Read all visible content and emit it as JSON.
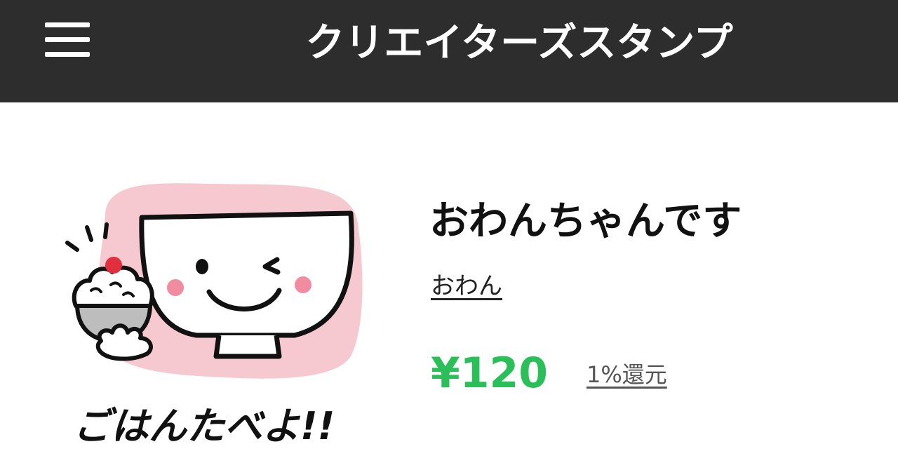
{
  "header": {
    "title": "クリエイターズスタンプ",
    "menu_icon": "hamburger-menu-icon"
  },
  "sticker": {
    "caption": "ごはんたべよ!!",
    "colors": {
      "background_blob": "#f6c9d0",
      "cheek": "#f08ba0",
      "umeboshi": "#e0303e"
    }
  },
  "product": {
    "title": "おわんちゃんです",
    "author": "おわん",
    "price": "¥120",
    "reward": "1%還元"
  },
  "colors": {
    "header_bg": "#2d2d2d",
    "price": "#2bbf5a"
  }
}
